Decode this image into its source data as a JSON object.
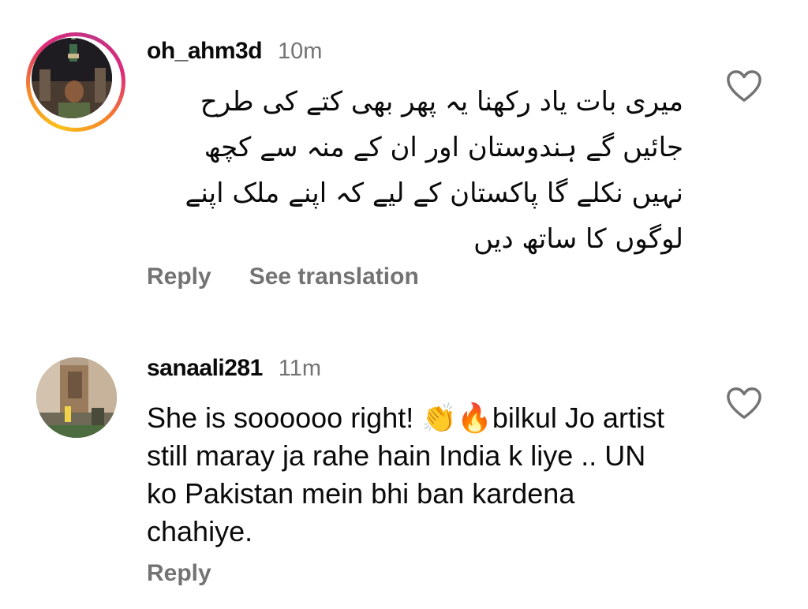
{
  "comments": [
    {
      "username": "oh_ahm3d",
      "time": "10m",
      "text_lines": [
        "میری بات یاد رکھنا یہ پھر بھی کتے کی طرح",
        "جائیں گے ہندوستان اور ان کے منہ سے کچھ",
        "نہیں نکلے گا پاکستان کے لیے کہ اپنے ملک اپنے",
        "لوگوں کا ساتھ دیں"
      ],
      "actions": {
        "reply": "Reply",
        "translate": "See translation"
      },
      "has_story_ring": true,
      "liked": false
    },
    {
      "username": "sanaali281",
      "time": "11m",
      "text": "She is soooooo right! 👏🔥bilkul Jo artist still maray ja rahe hain India k liye .. UN ko Pakistan mein bhi ban kardena chahiye.",
      "actions": {
        "reply": "Reply"
      },
      "has_story_ring": false,
      "liked": false
    }
  ],
  "icons": {
    "like": "heart-outline-icon"
  },
  "colors": {
    "text_primary": "#0a0a0a",
    "text_secondary": "#737373",
    "ring_gradient": [
      "#f9c21b",
      "#f58529",
      "#dd2a7b",
      "#c13584"
    ]
  }
}
